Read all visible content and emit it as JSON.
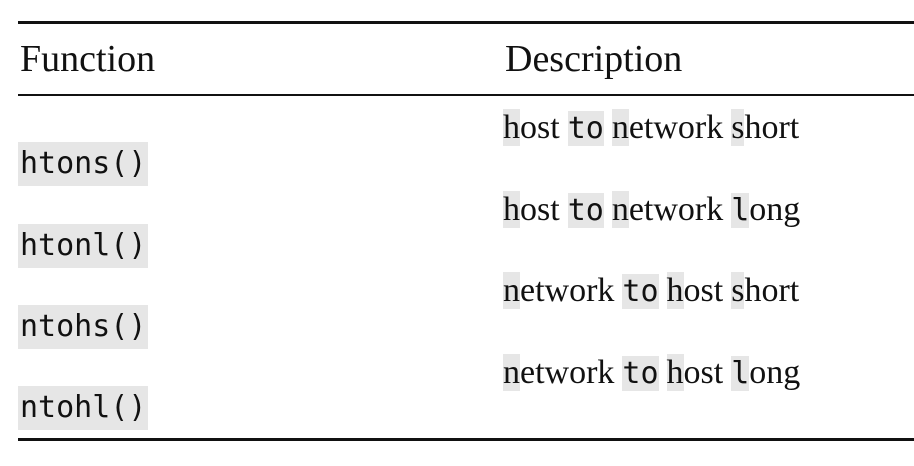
{
  "table": {
    "headers": {
      "function": "Function",
      "description": "Description"
    },
    "rows": [
      {
        "function": "htons()",
        "description": {
          "h": "h",
          "ost": "ost",
          "to": "to",
          "n": "n",
          "etwork": "etwork",
          "s": "s",
          "hort": "hort"
        }
      },
      {
        "function": "htonl()",
        "description": {
          "h": "h",
          "ost": "ost",
          "to": "to",
          "n": "n",
          "etwork": "etwork",
          "l": "l",
          "ong": "ong"
        }
      },
      {
        "function": "ntohs()",
        "description": {
          "n": "n",
          "etwork": "etwork",
          "to": "to",
          "h": "h",
          "ost": "ost",
          "s": "s",
          "hort": "hort"
        }
      },
      {
        "function": "ntohl()",
        "description": {
          "n": "n",
          "etwork": "etwork",
          "to": "to",
          "h": "h",
          "ost": "ost",
          "l": "l",
          "ong": "ong"
        }
      }
    ]
  }
}
